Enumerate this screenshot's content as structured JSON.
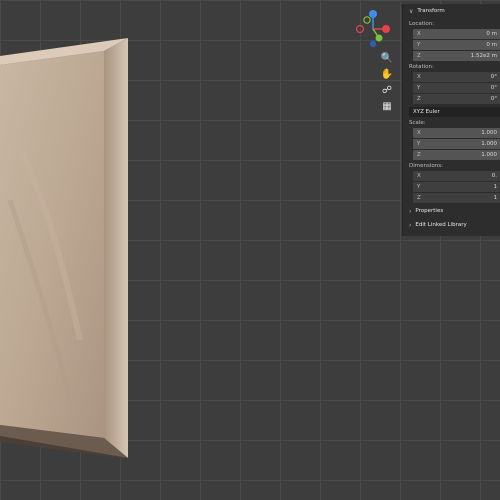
{
  "panel": {
    "transform_header": "Transform",
    "location_label": "Location:",
    "location": [
      {
        "axis": "X",
        "value": "0 m"
      },
      {
        "axis": "Y",
        "value": "0 m"
      },
      {
        "axis": "Z",
        "value": "1.52e2 m"
      }
    ],
    "rotation_label": "Rotation:",
    "rotation": [
      {
        "axis": "X",
        "value": "0°"
      },
      {
        "axis": "Y",
        "value": "0°"
      },
      {
        "axis": "Z",
        "value": "0°"
      }
    ],
    "rotation_mode": "XYZ Euler",
    "scale_label": "Scale:",
    "scale": [
      {
        "axis": "X",
        "value": "1.000"
      },
      {
        "axis": "Y",
        "value": "1.000"
      },
      {
        "axis": "Z",
        "value": "1.000"
      }
    ],
    "dimensions_label": "Dimensions:",
    "dimensions": [
      {
        "axis": "X",
        "value": "0."
      },
      {
        "axis": "Y",
        "value": "1"
      },
      {
        "axis": "Z",
        "value": "1"
      }
    ],
    "properties_label": "Properties",
    "edit_linked_label": "Edit Linked Library"
  },
  "gizmo": {
    "x_color": "#e8414b",
    "y_color": "#7cc23c",
    "z_color": "#3e8ef0"
  },
  "icons": [
    "zoom-icon",
    "hand-pan-icon",
    "camera-icon",
    "grid-icon"
  ]
}
